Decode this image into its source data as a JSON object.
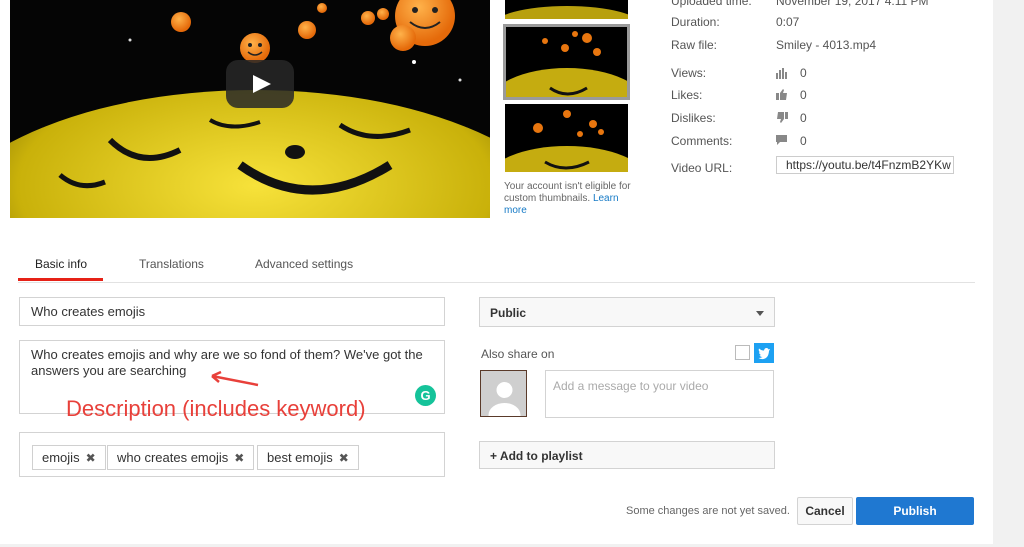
{
  "meta": {
    "uploaded_label": "Uploaded time:",
    "uploaded_value": "November 19, 2017 4:11 PM",
    "duration_label": "Duration:",
    "duration_value": "0:07",
    "raw_file_label": "Raw file:",
    "raw_file_value": "Smiley - 4013.mp4",
    "views_label": "Views:",
    "views_value": "0",
    "likes_label": "Likes:",
    "likes_value": "0",
    "dislikes_label": "Dislikes:",
    "dislikes_value": "0",
    "comments_label": "Comments:",
    "comments_value": "0",
    "url_label": "Video URL:",
    "url_value": "https://youtu.be/t4FnzmB2YKw"
  },
  "thumbnails": {
    "note": "Your account isn't eligible for custom thumbnails.",
    "learn_more": "Learn more"
  },
  "tabs": [
    {
      "label": "Basic info"
    },
    {
      "label": "Translations"
    },
    {
      "label": "Advanced settings"
    }
  ],
  "form": {
    "title_value": "Who creates emojis",
    "description_value": "Who creates emojis and why are we so fond of them? We've got the answers you are searching",
    "annotation": "Description (includes keyword)",
    "tags": [
      "emojis",
      "who creates emojis",
      "best emojis"
    ],
    "tag_remove": "✖",
    "grammarly": "G"
  },
  "sidebar_form": {
    "privacy_value": "Public",
    "share_label": "Also share on",
    "message_placeholder": "Add a message to your video",
    "playlist_label": "+ Add to playlist"
  },
  "footer": {
    "unsaved_text": "Some changes are not yet saved.",
    "cancel_label": "Cancel",
    "publish_label": "Publish"
  },
  "colors": {
    "accent": "#e62117",
    "publish": "#1f78d1",
    "twitter": "#1da1f2",
    "annotation": "#e8403a"
  }
}
